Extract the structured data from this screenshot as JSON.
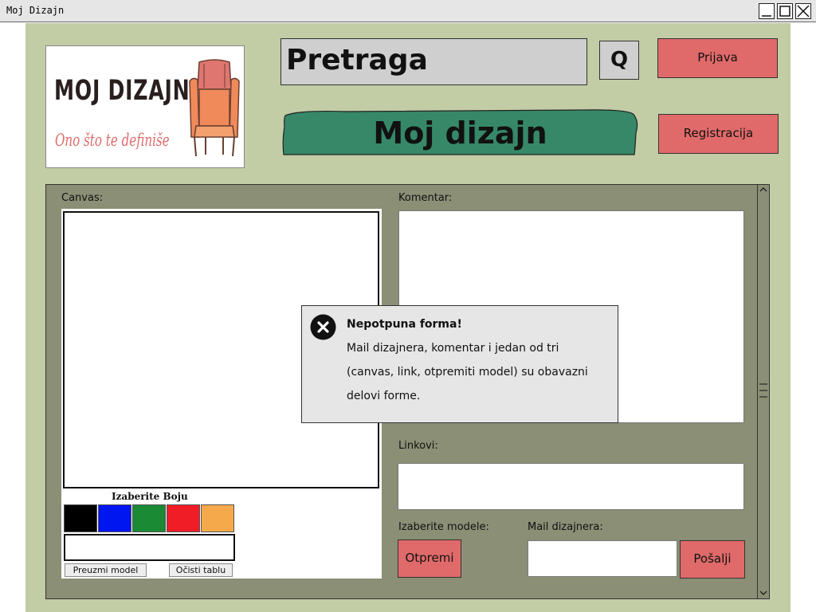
{
  "window": {
    "title": "Moj Dizajn"
  },
  "logo": {
    "line1": "MOJ DIZAJN",
    "line2": "Ono što te definiše"
  },
  "header": {
    "search_label": "Pretraga",
    "search_button": "Q",
    "login": "Prijava",
    "register": "Registracija",
    "banner": "Moj dizajn"
  },
  "canvas_section": {
    "label": "Canvas:",
    "color_title": "Izaberite Boju",
    "colors": [
      "#000000",
      "#0016f0",
      "#1a8a35",
      "#f01c26",
      "#f5a94b"
    ],
    "download_button": "Preuzmi model",
    "clear_button": "Očisti tablu"
  },
  "form": {
    "comment_label": "Komentar:",
    "links_label": "Linkovi:",
    "models_label": "Izaberite modele:",
    "upload_button": "Otpremi",
    "email_label": "Mail dizajnera:",
    "send_button": "Pošalji"
  },
  "dialog": {
    "title": "Nepotpuna forma!",
    "line1": "Mail dizajnera, komentar i jedan od tri",
    "line2": "(canvas, link, otpremiti model) su obavazni",
    "line3": "delovi forme."
  },
  "colors": {
    "page_bg": "#c2cca5",
    "panel_bg": "#8a8f75",
    "accent_red": "#e06a6a",
    "banner_green": "#368869"
  }
}
